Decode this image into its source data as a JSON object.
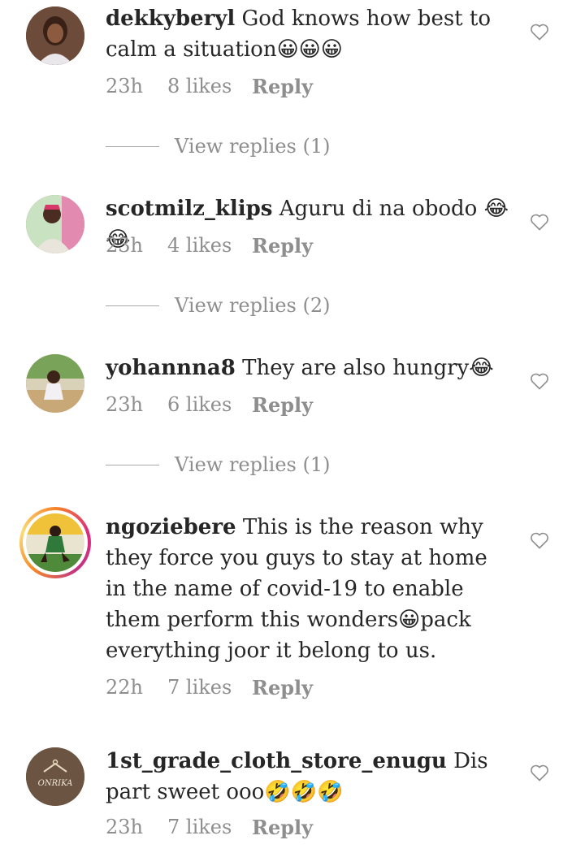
{
  "comments": [
    {
      "username": "dekkyberyl",
      "text": " God knows how best to calm a situation",
      "emoji": "😀😀😀",
      "time": "23h",
      "likes": "8 likes",
      "reply": "Reply",
      "view_replies": "View replies (1)"
    },
    {
      "username": "scotmilz_klips",
      "text": " Aguru di na obodo ",
      "emoji": "😂😂",
      "time": "23h",
      "likes": "4 likes",
      "reply": "Reply",
      "view_replies": "View replies (2)"
    },
    {
      "username": "yohannna8",
      "text": " They are also hungry",
      "emoji": "😂",
      "time": "23h",
      "likes": "6 likes",
      "reply": "Reply",
      "view_replies": "View replies (1)"
    },
    {
      "username": "ngoziebere",
      "text": " This is the reason why they force you guys to stay at home in the name of covid-19 to enable them perform this wonders",
      "emoji": "😀",
      "text_after": "pack everything joor it belong to us.",
      "time": "22h",
      "likes": "7 likes",
      "reply": "Reply"
    },
    {
      "username": "1st_grade_cloth_store_enugu",
      "text": " Dis part sweet ooo",
      "emoji": "🤣🤣🤣",
      "time": "23h",
      "likes": "7 likes",
      "reply": "Reply"
    }
  ],
  "avatar_logo_text": "ONRIKA",
  "icons": {
    "like": "heart-outline-icon"
  },
  "colors": {
    "text": "#262626",
    "muted": "#8e8e8e",
    "story_ring": "#dd2a7b"
  }
}
